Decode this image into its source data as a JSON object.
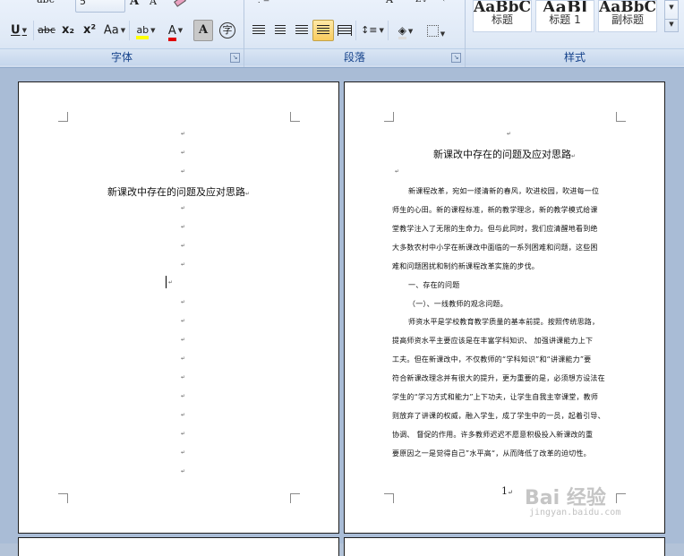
{
  "ribbon": {
    "font_group": {
      "label": "字体",
      "size_value": "5",
      "underline": "U",
      "strike": "abc",
      "subscript": "x₂",
      "superscript": "x²",
      "change_case": "Aa",
      "grow_font": "A",
      "shrink_font": "A",
      "highlight_letters": "ab",
      "font_color_letter": "A",
      "char_shading_letter": "A",
      "enclose_char": "字"
    },
    "paragraph_group": {
      "label": "段落"
    },
    "styles_group": {
      "label": "样式",
      "tiles": [
        {
          "preview": "AaBbC",
          "name": "标题"
        },
        {
          "preview": "AaBl",
          "name": "标题 1"
        },
        {
          "preview": "AaBbC",
          "name": "副标题"
        }
      ]
    },
    "colors": {
      "highlight": "#ffff00",
      "font_color": "#e00000"
    }
  },
  "page1": {
    "title": "新课改中存在的问题及应对思路",
    "mark": "↵"
  },
  "page2": {
    "title": "新课改中存在的问题及应对思路",
    "mark": "↵",
    "lines": [
      "新课程改革，宛如一缕清新的春风，吹进校园，吹进每一位",
      "师生的心田。新的课程标准，新的教学理念，新的教学模式给课",
      "堂教学注入了无限的生命力。但与此同时，我们应清醒地看到绝",
      "大多数农村中小学在新课改中面临的一系列困难和问题，这些困",
      "难和问题困扰和制约新课程改革实施的步伐。",
      "一、存在的问题",
      "（一）、一线教师的观念问题。",
      "师资水平是学校教育教学质量的基本前提。按照传统思路，",
      "提高师资水平主要应该是在丰富学科知识、 加强讲课能力上下",
      "工夫。但在新课改中，不仅教师的“学科知识”和“讲课能力”要",
      "符合新课改理念并有很大的提升，更为重要的是，必须想方设法在",
      "学生的“学习方式和能力”上下功夫，让学生自我主宰课堂，教师",
      "则放弃了讲课的权威，融入学生，成了学生中的一员，起着引导、",
      "协调、 督促的作用。许多教师迟迟不愿意积极投入新课改的重",
      "要原因之一是觉得自己”水平高“，从而降低了改革的迫切性。"
    ],
    "page_number": "1"
  },
  "watermark": {
    "brand": "Bai 经验",
    "url": "jingyan.baidu.com"
  }
}
